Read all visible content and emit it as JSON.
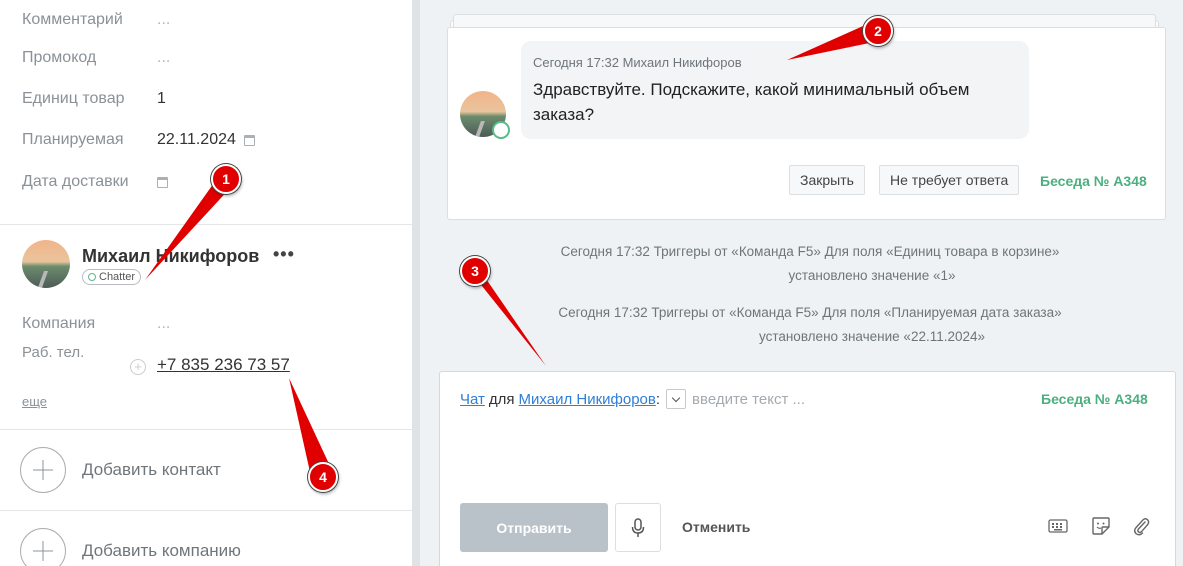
{
  "fields": [
    {
      "label": "Комментарий",
      "value": "..."
    },
    {
      "label": "Промокод",
      "value": "..."
    },
    {
      "label": "Единиц товар",
      "value": "1"
    },
    {
      "label": "Планируемая",
      "value": "22.11.2024"
    },
    {
      "label": "Дата доставки",
      "value": ""
    }
  ],
  "contact": {
    "name": "Михаил Никифоров",
    "badge": "Chatter",
    "more_icon": "ellipsis-icon",
    "company_label": "Компания",
    "company_value": "...",
    "phone_label": "Раб. тел.",
    "phone": "+7 835 236 73 57",
    "more_link": "еще"
  },
  "actions": {
    "add_contact": "Добавить контакт",
    "add_company": "Добавить компанию"
  },
  "message": {
    "meta": "Сегодня 17:32 Михаил Никифоров",
    "text": "Здравствуйте. Подскажите, какой минимальный объем заказа?",
    "close_label": "Закрыть",
    "no_reply_label": "Не требует ответа",
    "conversation": "Беседа № A348"
  },
  "events": [
    {
      "line1": "Сегодня 17:32 Триггеры от «Команда F5» Для поля «Единиц товара в корзине»",
      "line2": "установлено значение «1»"
    },
    {
      "line1": "Сегодня 17:32 Триггеры от «Команда F5» Для поля «Планируемая дата заказа»",
      "line2": "установлено значение «22.11.2024»"
    }
  ],
  "composer": {
    "chat_link": "Чат",
    "for_word": "для",
    "recipient": "Михаил Никифоров",
    "colon": ":",
    "placeholder": "введите текст ...",
    "conversation": "Беседа № A348",
    "send_label": "Отправить",
    "cancel_label": "Отменить"
  },
  "markers": [
    "1",
    "2",
    "3",
    "4"
  ],
  "colors": {
    "accent_green": "#4caf7f",
    "link_blue": "#2f7ed8",
    "marker_red": "#e00000"
  }
}
